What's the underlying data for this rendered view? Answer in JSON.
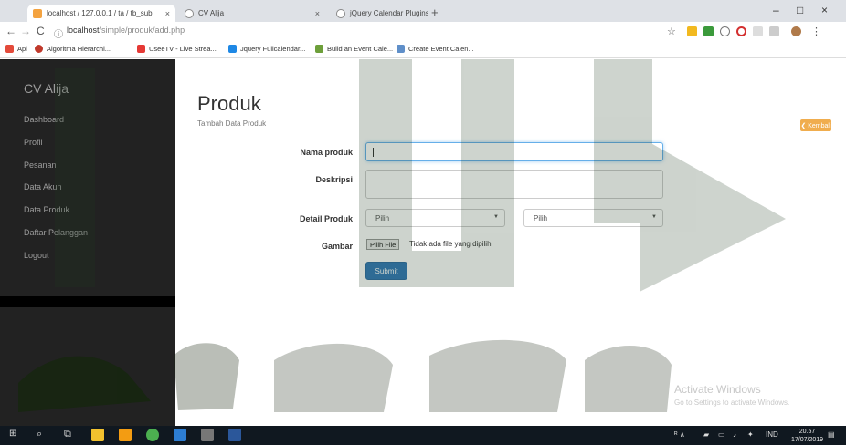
{
  "browser": {
    "tabs": [
      {
        "title": "localhost / 127.0.0.1 / ta / tb_sub",
        "close": "×"
      },
      {
        "title": "CV Alija",
        "close": "×"
      },
      {
        "title": "jQuery Calendar Plugins | jQuery",
        "close": "×"
      }
    ],
    "new_tab": "+",
    "window_controls": [
      "–",
      "□",
      "×"
    ],
    "nav": {
      "back": "←",
      "forward": "→",
      "reload": "C",
      "info": "ⓘ"
    },
    "url_host": "localhost",
    "url_path": "/simple/produk/add.php",
    "bookmarks": [
      {
        "label": "Apl",
        "icon": "apps-icon",
        "color": "#e34a3a"
      },
      {
        "label": "Algoritma Hierarchi...",
        "icon": "bookmark-favicon",
        "color": "#c0392b"
      },
      {
        "label": "UseeTV - Live Strea...",
        "icon": "bookmark-favicon",
        "color": "#e53935"
      },
      {
        "label": "Jquery Fullcalendar...",
        "icon": "bookmark-favicon",
        "color": "#1e88e5"
      },
      {
        "label": "Build an Event Cale...",
        "icon": "bookmark-favicon",
        "color": "#6d9f3a"
      },
      {
        "label": "Create Event Calen...",
        "icon": "bookmark-favicon",
        "color": "#5f8fc9"
      }
    ]
  },
  "sidebar": {
    "brand": "CV Alija",
    "items": [
      "Dashboard",
      "Profil",
      "Pesanan",
      "Data Akun",
      "Data Produk",
      "Daftar Pelanggan",
      "Logout"
    ]
  },
  "main": {
    "title": "Produk",
    "subtitle": "Tambah Data Produk",
    "back_button": "❮ Kembali",
    "form": {
      "nama_label": "Nama produk",
      "deskripsi_label": "Deskripsi",
      "detail_label": "Detail Produk",
      "select1": "Pilih",
      "select2": "Pilih",
      "gambar_label": "Gambar",
      "file_button": "Pilih File",
      "file_status": "Tidak ada file yang dipilih",
      "submit": "Submit"
    }
  },
  "windows_notice": {
    "line1": "Activate Windows",
    "line2": "Go to Settings to activate Windows."
  },
  "taskbar": {
    "tray_left": "ᴿ   ∧",
    "lang": "IND",
    "time": "20.57",
    "date": "17/07/2019"
  },
  "colors": {
    "sidebar": "#222222",
    "accent_blue": "#337ab7",
    "warning": "#f0ad4e",
    "watermark_green": "#1f3b1f"
  }
}
